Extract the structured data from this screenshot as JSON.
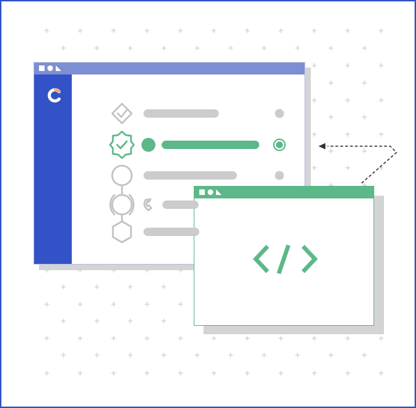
{
  "colors": {
    "frame_border": "#2f53c4",
    "main_titlebar": "#7c8fd3",
    "sidebar": "#3352c7",
    "code_accent": "#5cb888",
    "inactive_gray": "#cccccc",
    "shadow": "#d4d4d4",
    "grid_plus": "#c9c9c9"
  },
  "main_window": {
    "titlebar_icons": [
      "square-icon",
      "circle-icon",
      "triangle-icon"
    ],
    "sidebar_logo": "logo-icon",
    "steps": [
      {
        "icon": "diamond-check-icon",
        "state": "inactive",
        "has_status_dot": true
      },
      {
        "icon": "gear-check-icon",
        "state": "active",
        "has_status_dot": true
      },
      {
        "icon": "circle-icon",
        "state": "inactive",
        "has_status_dot": true
      },
      {
        "icon": "phone-icon",
        "state": "inactive",
        "has_status_dot": false
      },
      {
        "icon": "hexagon-icon",
        "state": "inactive",
        "has_status_dot": false
      }
    ]
  },
  "code_window": {
    "titlebar_icons": [
      "square-icon",
      "circle-icon",
      "triangle-icon"
    ],
    "content_icon": "code-brackets-icon"
  },
  "connector": {
    "style": "dashed",
    "arrow": "arrow-left-icon"
  }
}
